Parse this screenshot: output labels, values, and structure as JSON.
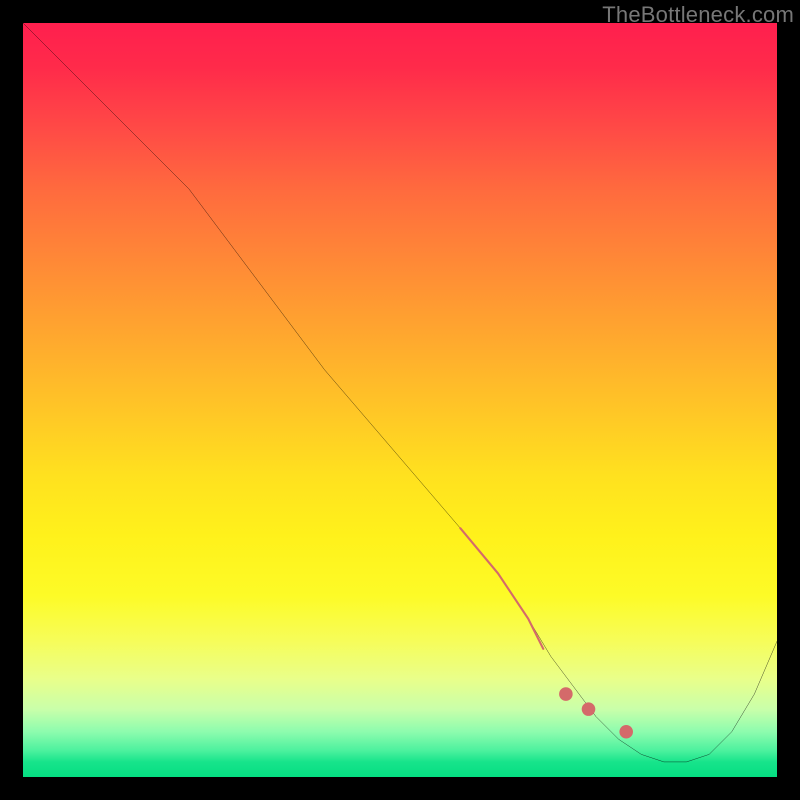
{
  "watermark": "TheBottleneck.com",
  "chart_data": {
    "type": "line",
    "title": "",
    "xlabel": "",
    "ylabel": "",
    "xlim": [
      0,
      100
    ],
    "ylim": [
      0,
      100
    ],
    "grid": false,
    "legend": false,
    "note": "No axis ticks or numeric labels are present; values are estimated from pixel positions on a 0–100 normalized scale.",
    "series": [
      {
        "name": "curve",
        "stroke": "#000000",
        "x": [
          0,
          6,
          12,
          17,
          22,
          28,
          34,
          40,
          46,
          52,
          58,
          63,
          67,
          70,
          73,
          76,
          79,
          82,
          85,
          88,
          91,
          94,
          97,
          100
        ],
        "y": [
          100,
          94,
          88,
          83,
          78,
          70,
          62,
          54,
          47,
          40,
          33,
          27,
          21,
          16,
          12,
          8,
          5,
          3,
          2,
          2,
          3,
          6,
          11,
          18
        ]
      },
      {
        "name": "highlight-segment",
        "stroke": "#d46a6a",
        "style": "thick",
        "x": [
          58,
          63,
          67,
          69
        ],
        "y": [
          33,
          27,
          21,
          17
        ]
      },
      {
        "name": "highlight-dots",
        "stroke": "#d46a6a",
        "style": "dots",
        "x": [
          72,
          75,
          80
        ],
        "y": [
          11,
          9,
          6
        ]
      }
    ],
    "gradient_background": {
      "direction": "vertical",
      "stops": [
        {
          "pos": 0.0,
          "color": "#ff1f4e"
        },
        {
          "pos": 0.32,
          "color": "#ff8a36"
        },
        {
          "pos": 0.6,
          "color": "#ffe11f"
        },
        {
          "pos": 0.82,
          "color": "#f6fd5a"
        },
        {
          "pos": 0.94,
          "color": "#8dfcae"
        },
        {
          "pos": 1.0,
          "color": "#05de82"
        }
      ]
    }
  }
}
